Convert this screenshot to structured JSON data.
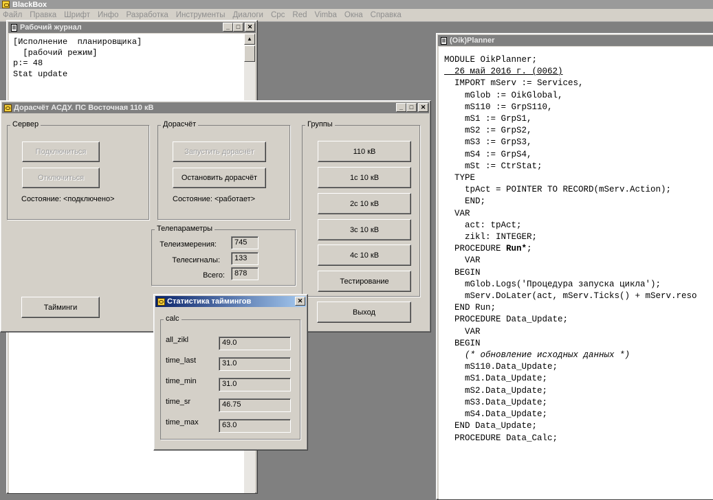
{
  "app": {
    "title": "BlackBox",
    "menu": [
      "Файл",
      "Правка",
      "Шрифт",
      "Инфо",
      "Разработка",
      "Инструменты",
      "Диалоги",
      "Cpc",
      "Red",
      "Vimba",
      "Окна",
      "Справка"
    ]
  },
  "journal": {
    "title": "Рабочий журнал",
    "lines": [
      "[Исполнение  планировщика]",
      "  [рабочий режим]",
      "p:= 48",
      "Stat update"
    ]
  },
  "main": {
    "title": "Дорасчёт АСДУ. ПС Восточная 110 кВ",
    "server": {
      "label": "Сервер",
      "connect": "Подключиться",
      "disconnect": "Отключиться",
      "status": "Состояние: <подключено>"
    },
    "calc": {
      "label": "Дорасчёт",
      "start": "Запустить дорасчёт",
      "stop": "Остановить дорасчёт",
      "status": "Состояние: <работает>"
    },
    "telemetry": {
      "label": "Телепараметры",
      "rows": [
        {
          "label": "Телеизмерения:",
          "value": "745"
        },
        {
          "label": "Телесигналы:",
          "value": "133"
        },
        {
          "label": "Всего:",
          "value": "878"
        }
      ]
    },
    "groups": {
      "label": "Группы",
      "buttons": [
        "110 кВ",
        "1с 10 кВ",
        "2с 10 кВ",
        "3с 10 кВ",
        "4с 10 кВ",
        "Тестирование"
      ]
    },
    "timings_button": "Тайминги",
    "exit_button": "Выход"
  },
  "timings": {
    "title": "Статистика таймингов",
    "group": "calc",
    "rows": [
      {
        "label": "all_zikl",
        "value": "49.0"
      },
      {
        "label": "time_last",
        "value": "31.0"
      },
      {
        "label": "time_min",
        "value": "31.0"
      },
      {
        "label": "time_sr",
        "value": "46.75"
      },
      {
        "label": "time_max",
        "value": "63.0"
      }
    ]
  },
  "planner": {
    "title": "(Oik)Planner",
    "code": [
      {
        "t": "MODULE OikPlanner;"
      },
      {
        "t": "  26 май 2016 г. (0062)",
        "style": "underline"
      },
      {
        "t": ""
      },
      {
        "t": "  IMPORT mServ := Services,"
      },
      {
        "t": "    mGlob := OikGlobal,"
      },
      {
        "t": "    mS110 := GrpS110,"
      },
      {
        "t": "    mS1 := GrpS1,"
      },
      {
        "t": "    mS2 := GrpS2,"
      },
      {
        "t": "    mS3 := GrpS3,"
      },
      {
        "t": "    mS4 := GrpS4,"
      },
      {
        "t": "    mSt := CtrStat;"
      },
      {
        "t": "  TYPE"
      },
      {
        "t": "    tpAct = POINTER TO RECORD(mServ.Action);"
      },
      {
        "t": "    END;"
      },
      {
        "t": "  VAR"
      },
      {
        "t": "    act: tpAct;"
      },
      {
        "t": "    zikl: INTEGER;"
      },
      {
        "t": ""
      },
      {
        "t": "  PROCEDURE Run*;",
        "style": "bold-name"
      },
      {
        "t": "    VAR"
      },
      {
        "t": "  BEGIN"
      },
      {
        "t": "    mGlob.Logs('Процедура запуска цикла');"
      },
      {
        "t": "    mServ.DoLater(act, mServ.Ticks() + mServ.reso"
      },
      {
        "t": "  END Run;"
      },
      {
        "t": ""
      },
      {
        "t": "  PROCEDURE Data_Update;"
      },
      {
        "t": "    VAR"
      },
      {
        "t": "  BEGIN"
      },
      {
        "t": "    (* обновление исходных данных *)",
        "style": "italic"
      },
      {
        "t": "    mS110.Data_Update;"
      },
      {
        "t": "    mS1.Data_Update;"
      },
      {
        "t": "    mS2.Data_Update;"
      },
      {
        "t": "    mS3.Data_Update;"
      },
      {
        "t": "    mS4.Data_Update;"
      },
      {
        "t": "  END Data_Update;"
      },
      {
        "t": ""
      },
      {
        "t": "  PROCEDURE Data_Calc;"
      }
    ]
  }
}
